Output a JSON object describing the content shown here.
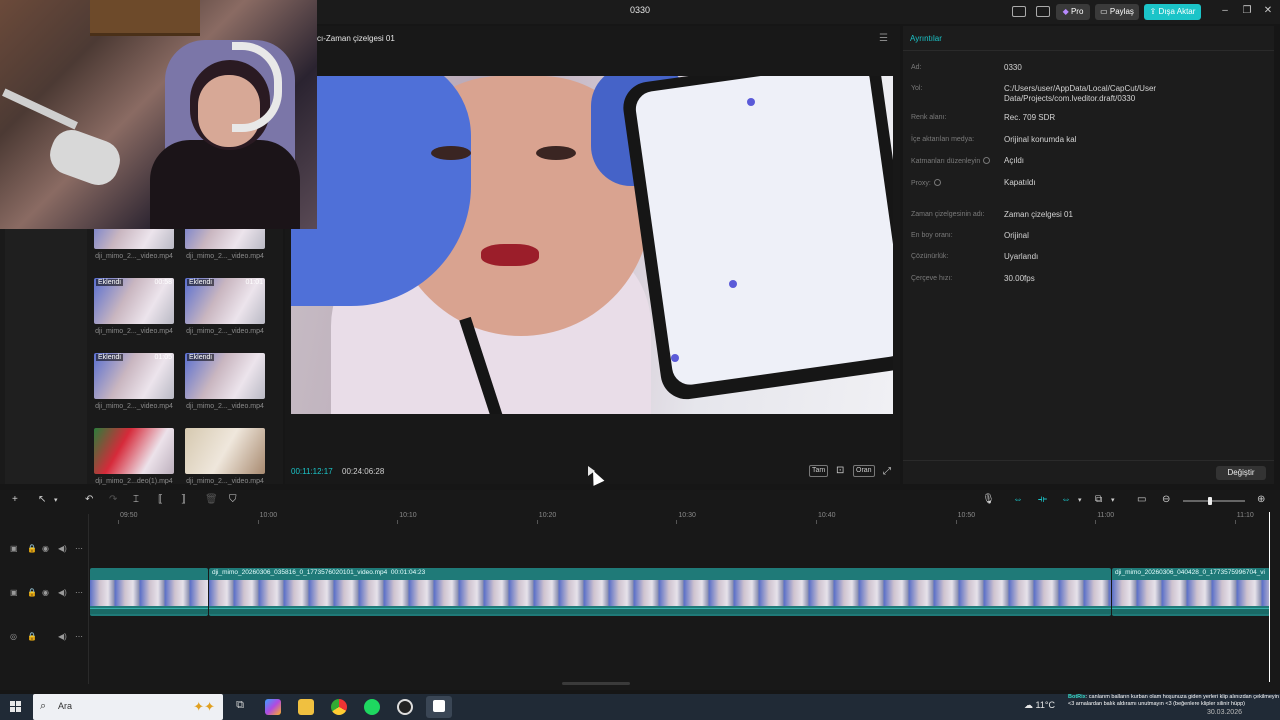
{
  "titlebar": {
    "title": "0330",
    "pro_label": "Pro",
    "share_label": "Paylaş",
    "export_label": "Dışa Aktar"
  },
  "player": {
    "title": "cı-Zaman çizelgesi 01",
    "current_time": "00:11:12:17",
    "duration": "00:24:06:28",
    "btn_full": "Tam",
    "btn_ratio": "Oran"
  },
  "media": {
    "items": [
      {
        "label": "dji_mimo_2..._video.mp4",
        "badge": "",
        "duration": ""
      },
      {
        "label": "dji_mimo_2..._video.mp4",
        "badge": "",
        "duration": ""
      },
      {
        "label": "dji_mimo_2..._video.mp4",
        "badge": "Eklendi",
        "duration": "00:58"
      },
      {
        "label": "dji_mimo_2..._video.mp4",
        "badge": "Eklendi",
        "duration": "01:01"
      },
      {
        "label": "dji_mimo_2..._video.mp4",
        "badge": "Eklendi",
        "duration": "01:05"
      },
      {
        "label": "dji_mimo_2..._video.mp4",
        "badge": "Eklendi",
        "duration": ""
      },
      {
        "label": "dji_mimo_2...deo(1).mp4",
        "badge": "",
        "duration": ""
      },
      {
        "label": "dji_mimo_2..._video.mp4",
        "badge": "",
        "duration": ""
      }
    ]
  },
  "details": {
    "title": "Ayrıntılar",
    "rows": [
      {
        "label": "Ad:",
        "value": "0330"
      },
      {
        "label": "Yol:",
        "value": "C:/Users/user/AppData/Local/CapCut/User Data/Projects/com.lveditor.draft/0330"
      },
      {
        "label": "Renk alanı:",
        "value": "Rec. 709 SDR"
      },
      {
        "label": "İçe aktarılan medya:",
        "value": "Orijinal konumda kal"
      },
      {
        "label": "Katmanları düzenleyin",
        "value": "Açıldı"
      },
      {
        "label": "Proxy:",
        "value": "Kapatıldı"
      },
      {
        "label": "Zaman çizelgesinin adı:",
        "value": "Zaman çizelgesi 01"
      },
      {
        "label": "En boy oranı:",
        "value": "Orijinal"
      },
      {
        "label": "Çözünürlük:",
        "value": "Uyarlandı"
      },
      {
        "label": "Çerçeve hızı:",
        "value": "30.00fps"
      }
    ],
    "change_label": "Değiştir"
  },
  "timeline": {
    "ruler_ticks": [
      "09:50",
      "10:00",
      "10:10",
      "10:20",
      "10:30",
      "10:40",
      "10:50",
      "11:00",
      "11:10"
    ],
    "clip_main_label": "dji_mimo_20260306_035816_0_1773576020101_video.mp4",
    "clip_main_duration": "00:01:04:23",
    "clip_next_label": "dji_mimo_20260306_040428_0_1773575996704_vi",
    "zoom_level": 0.43
  },
  "taskbar": {
    "search_placeholder": "Ara",
    "temperature": "11°C",
    "chat_user": "BotRix",
    "chat_message": ": canlarım balların kurban olam hoşunuza giden yerleri klip alınızdan çekilmeyin <3 arnalardan balık aldıramı unutmayın <3 (beğenlere klipler silinir hüpp)",
    "date": "30.03.2026"
  },
  "colors": {
    "accent": "#1bc4c8",
    "clip": "#1f7a78",
    "taskbar": "#202a36"
  }
}
